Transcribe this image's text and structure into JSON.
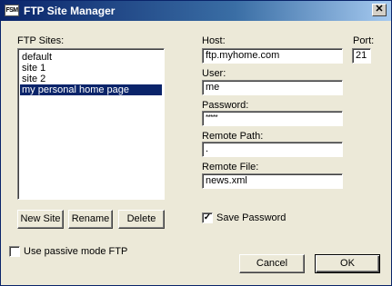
{
  "window": {
    "title": "FTP Site Manager",
    "app_icon_text": "FSM",
    "close_glyph": "✕"
  },
  "sites": {
    "label": "FTP Sites:",
    "items": [
      "default",
      "site 1",
      "site 2",
      "my personal home page"
    ],
    "selected": "my personal home page"
  },
  "fields": {
    "host_label": "Host:",
    "host_value": "ftp.myhome.com",
    "port_label": "Port:",
    "port_value": "21",
    "user_label": "User:",
    "user_value": "me",
    "password_label": "Password:",
    "password_value": "*****",
    "remote_path_label": "Remote Path:",
    "remote_path_value": ".",
    "remote_file_label": "Remote File:",
    "remote_file_value": "news.xml"
  },
  "buttons": {
    "new_site": "New Site",
    "rename": "Rename",
    "delete": "Delete",
    "cancel": "Cancel",
    "ok": "OK"
  },
  "options": {
    "save_password_label": "Save Password",
    "save_password_checked": true,
    "check_glyph": "✓",
    "passive_mode_label": "Use passive mode FTP",
    "passive_mode_checked": false
  },
  "colors": {
    "selection": "#0a246a",
    "dialog_bg": "#ece9d8",
    "title_bar": "#0a246a"
  }
}
